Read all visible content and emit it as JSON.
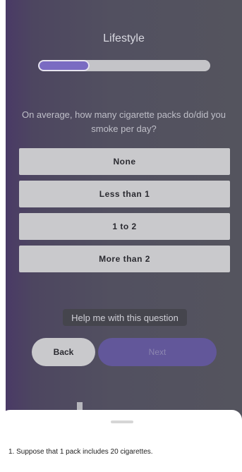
{
  "header": {
    "title": "Lifestyle"
  },
  "progress": {
    "fraction": 0.3
  },
  "question": {
    "text": "On average, how many cigarette packs do/did you smoke per day?"
  },
  "options": [
    {
      "label": "None"
    },
    {
      "label": "Less than 1"
    },
    {
      "label": "1 to 2"
    },
    {
      "label": "More than 2"
    }
  ],
  "help": {
    "label": "Help me with this question"
  },
  "nav": {
    "back_label": "Back",
    "next_label": "Next"
  },
  "sheet": {
    "note": "1. Suppose that 1 pack includes 20 cigarettes."
  },
  "colors": {
    "accent": "#7a6bc2",
    "option_bg": "#c9c9cc",
    "next_bg": "#62579a"
  }
}
